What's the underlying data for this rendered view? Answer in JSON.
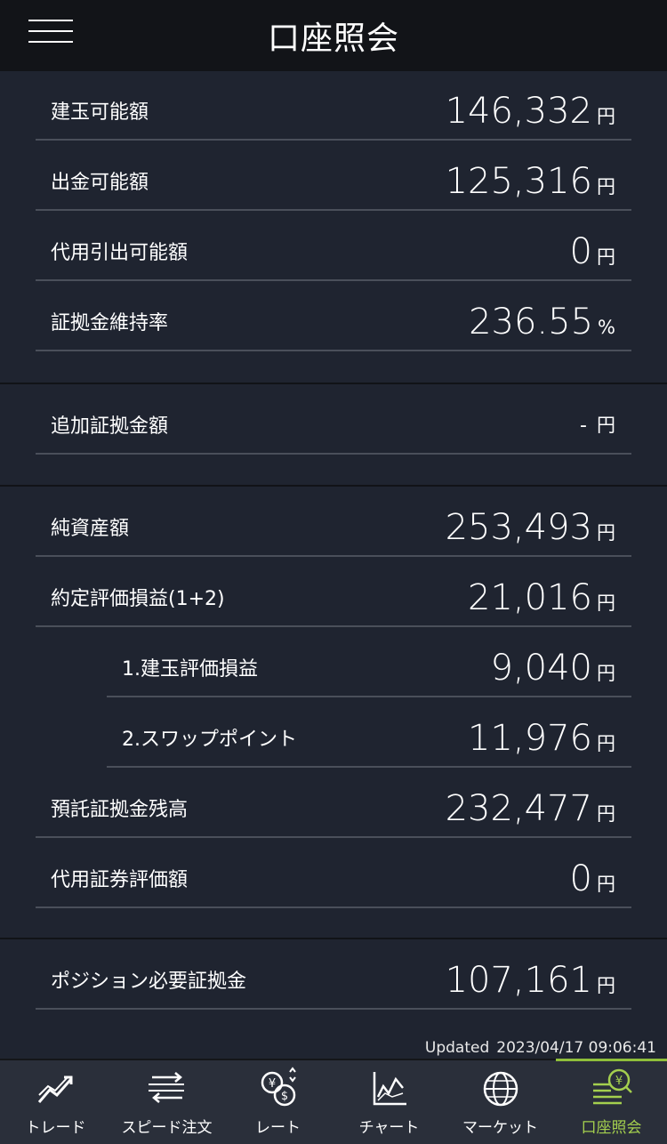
{
  "header": {
    "title": "口座照会",
    "menu_icon": "hamburger-icon"
  },
  "section1": {
    "rows": [
      {
        "label": "建玉可能額",
        "value": "146,332",
        "unit": "円"
      },
      {
        "label": "出金可能額",
        "value": "125,316",
        "unit": "円"
      },
      {
        "label": "代用引出可能額",
        "value": "0",
        "unit": "円"
      },
      {
        "label": "証拠金維持率",
        "value": "236.55",
        "unit": "%"
      }
    ]
  },
  "section2": {
    "rows": [
      {
        "label": "追加証拠金額",
        "value": "-",
        "unit": "円"
      }
    ]
  },
  "section3": {
    "rows": [
      {
        "label": "純資産額",
        "value": "253,493",
        "unit": "円"
      },
      {
        "label": "約定評価損益(1+2)",
        "value": "21,016",
        "unit": "円"
      },
      {
        "label": "1.建玉評価損益",
        "value": "9,040",
        "unit": "円"
      },
      {
        "label": "2.スワップポイント",
        "value": "11,976",
        "unit": "円"
      },
      {
        "label": "預託証拠金残高",
        "value": "232,477",
        "unit": "円"
      },
      {
        "label": "代用証券評価額",
        "value": "0",
        "unit": "円"
      }
    ]
  },
  "section4": {
    "rows": [
      {
        "label": "ポジション必要証拠金",
        "value": "107,161",
        "unit": "円"
      }
    ]
  },
  "updated": {
    "label": "Updated",
    "timestamp": "2023/04/17 09:06:41"
  },
  "nav": {
    "active_color": "#a4cf4e",
    "items": [
      {
        "label": "トレード",
        "icon": "trend-chart-icon"
      },
      {
        "label": "スピード注文",
        "icon": "speed-order-icon"
      },
      {
        "label": "レート",
        "icon": "currency-exchange-icon"
      },
      {
        "label": "チャート",
        "icon": "line-chart-icon"
      },
      {
        "label": "マーケット",
        "icon": "globe-icon"
      },
      {
        "label": "口座照会",
        "icon": "account-yen-icon"
      }
    ]
  }
}
